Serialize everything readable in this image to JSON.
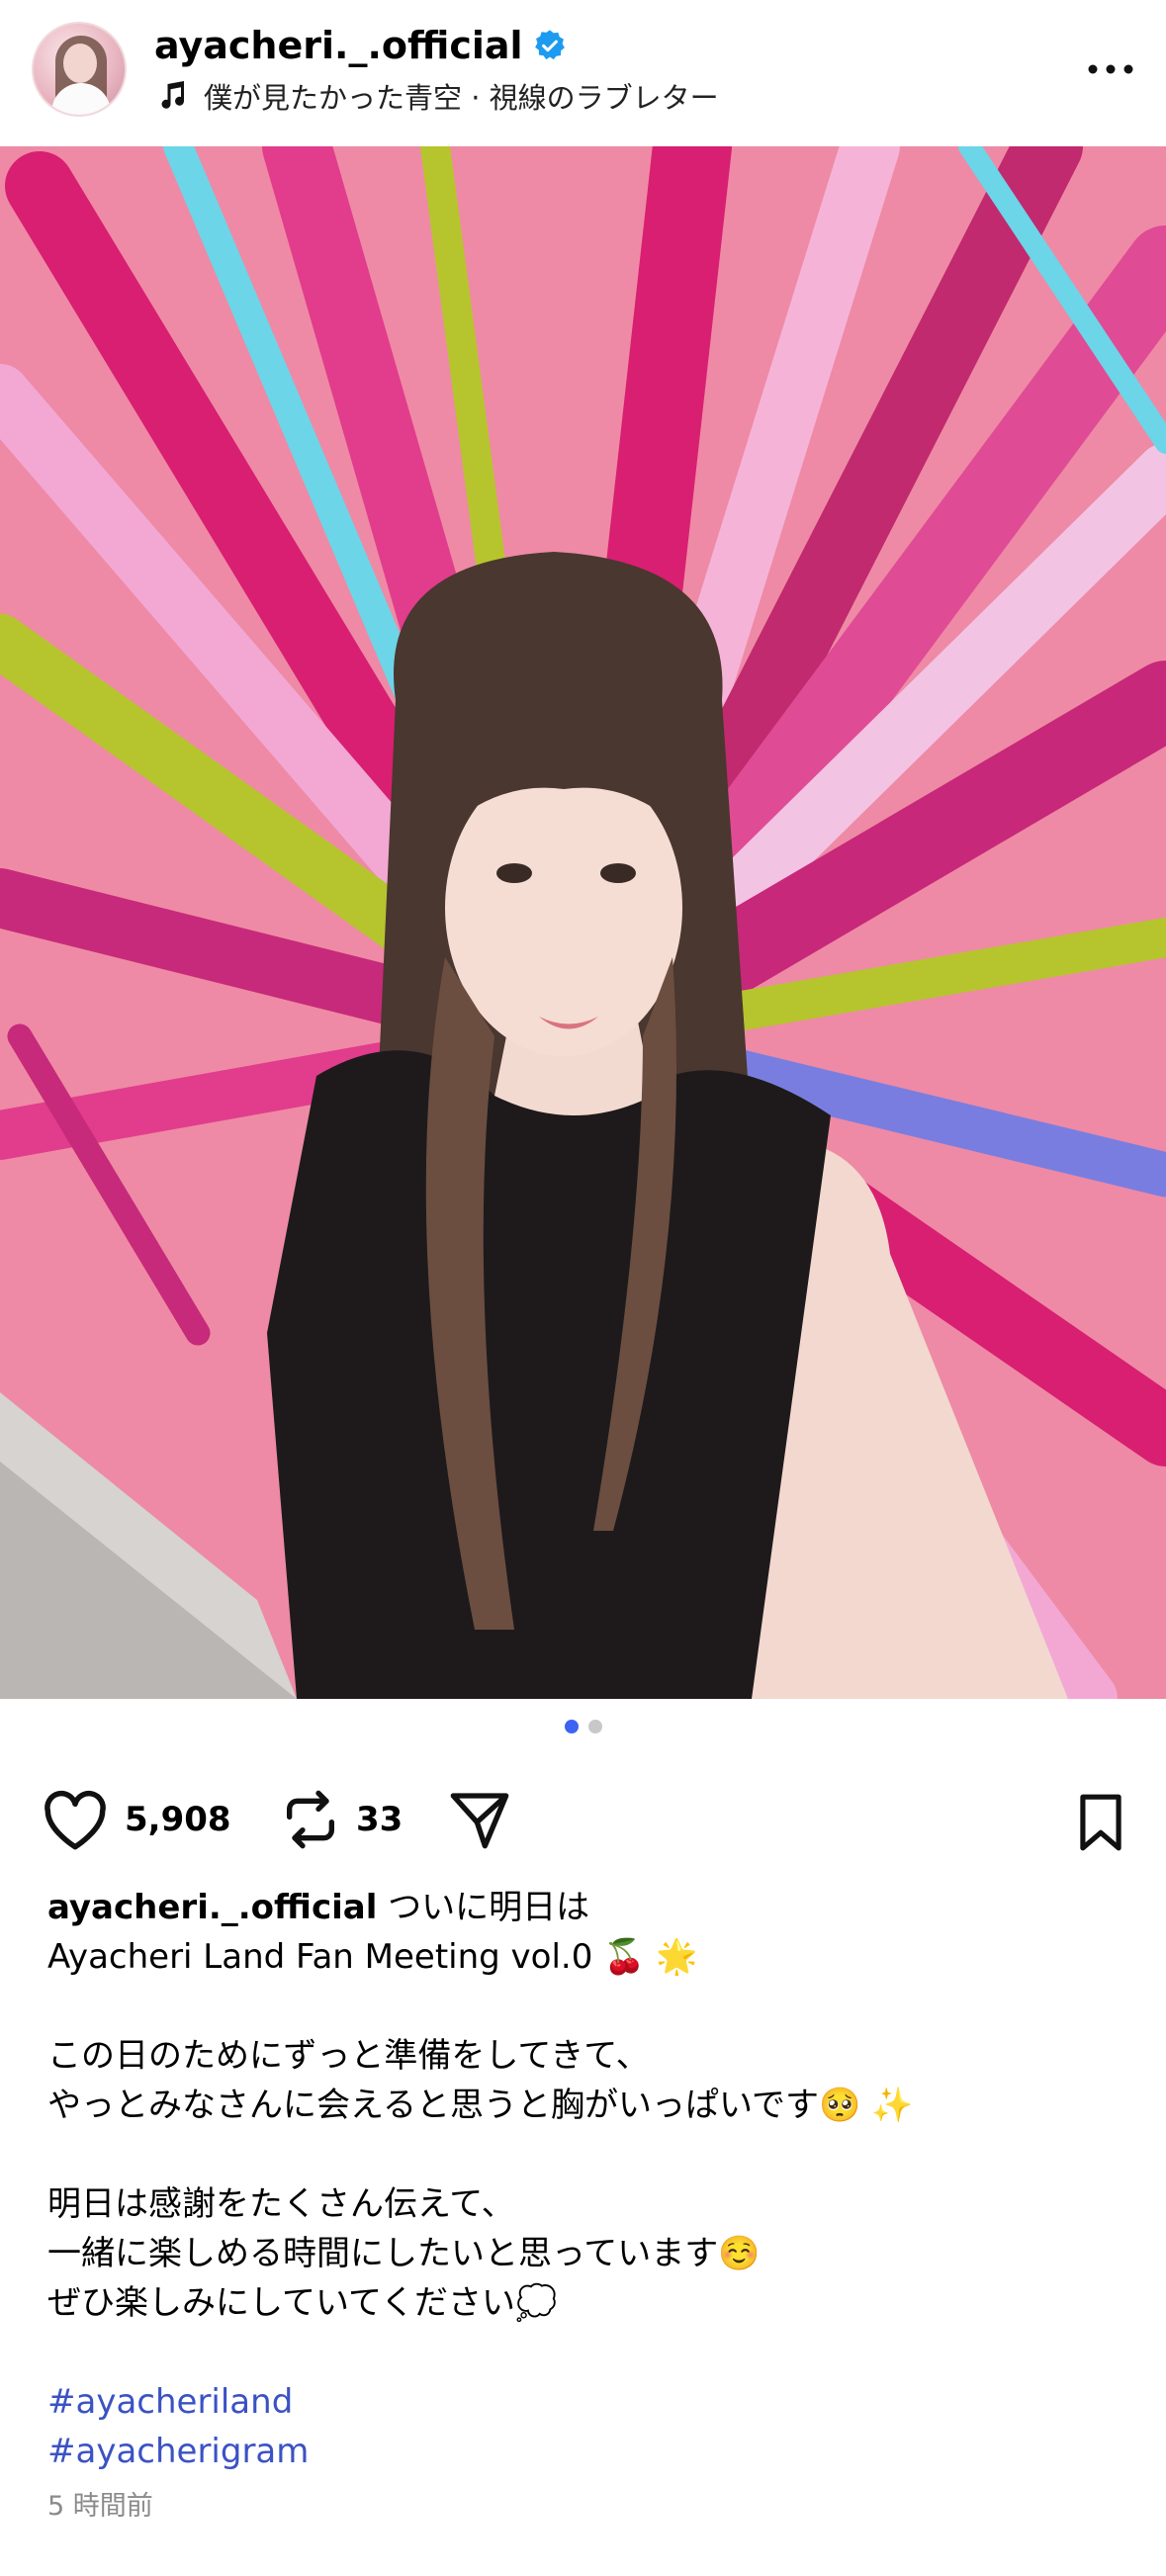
{
  "header": {
    "username": "ayacheri._.official",
    "verified": true,
    "music": "僕が見たかった青空 · 視線のラブレター"
  },
  "post": {
    "media_index": 1,
    "media_count": 2,
    "muted": true
  },
  "actions": {
    "likes": "5,908",
    "reposts": "33"
  },
  "caption": {
    "username": "ayacheri._.official",
    "line1": "ついに明日は",
    "line2": "Ayacheri Land Fan Meeting vol.0 🍒 🌟",
    "line3": "この日のためにずっと準備をしてきて、",
    "line4": "やっとみなさんに会えると思うと胸がいっぱいです🥺 ✨",
    "line5": "明日は感謝をたくさん伝えて、",
    "line6": "一緒に楽しめる時間にしたいと思っています☺️",
    "line7": "ぜひ楽しみにしていてください💭",
    "hashtags": [
      "#ayacheriland",
      "#ayacherigram"
    ],
    "timestamp": "5 時間前"
  },
  "colors": {
    "accent_blue": "#3d63f3",
    "hashtag": "#3b52c4",
    "verified": "#1d9bf0"
  }
}
